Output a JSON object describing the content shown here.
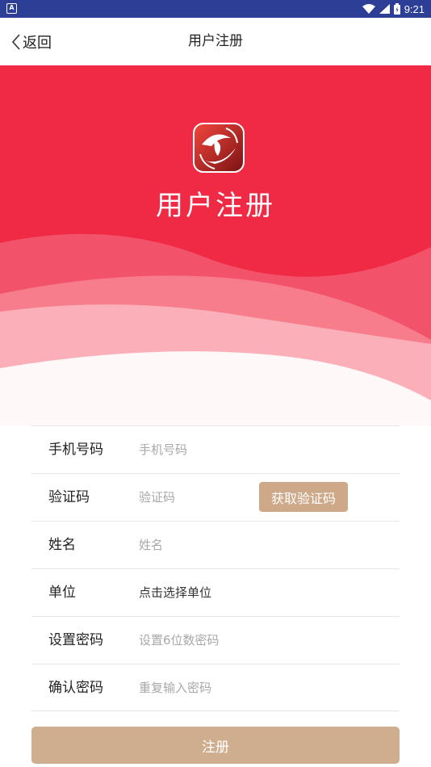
{
  "status_bar": {
    "time": "9:21",
    "notification_icon": "a-icon",
    "icons": [
      "wifi-icon",
      "signal-icon",
      "battery-icon"
    ]
  },
  "nav": {
    "back_label": "返回",
    "title": "用户注册"
  },
  "banner": {
    "title": "用户注册",
    "colors": {
      "base": "#f02a45",
      "wave1": "#f3536a",
      "wave2": "#f77d8d",
      "wave3": "#fbb0b9",
      "wave4": "#fff8f8"
    }
  },
  "form": {
    "phone": {
      "label": "手机号码",
      "placeholder": "手机号码",
      "value": ""
    },
    "code": {
      "label": "验证码",
      "placeholder": "验证码",
      "value": "",
      "button_label": "获取验证码"
    },
    "name": {
      "label": "姓名",
      "placeholder": "姓名",
      "value": ""
    },
    "unit": {
      "label": "单位",
      "value": "点击选择单位"
    },
    "password": {
      "label": "设置密码",
      "placeholder": "设置6位数密码",
      "value": ""
    },
    "confirm_password": {
      "label": "确认密码",
      "placeholder": "重复输入密码",
      "value": ""
    }
  },
  "submit": {
    "label": "注册",
    "color": "#cfae90"
  }
}
